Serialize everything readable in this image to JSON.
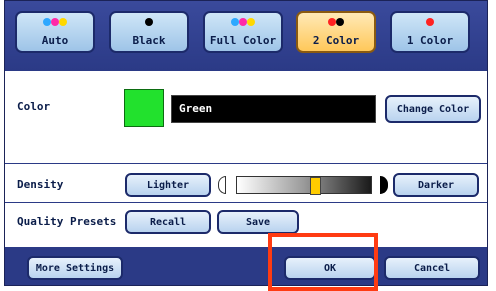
{
  "color_modes": [
    {
      "label": "Auto",
      "dots": [
        "#2ea8ff",
        "#ff2aa8",
        "#ffd800"
      ],
      "selected": false
    },
    {
      "label": "Black",
      "dots": [
        "#000000"
      ],
      "selected": false
    },
    {
      "label": "Full Color",
      "dots": [
        "#2ea8ff",
        "#ff2aa8",
        "#ffd800"
      ],
      "selected": false
    },
    {
      "label": "2 Color",
      "dots": [
        "#ff2222",
        "#000000"
      ],
      "selected": true
    },
    {
      "label": "1 Color",
      "dots": [
        "#ff2222"
      ],
      "selected": false
    }
  ],
  "color_row": {
    "label": "Color",
    "swatch_color": "#22e12d",
    "value": "Green",
    "change_button": "Change Color"
  },
  "density_row": {
    "label": "Density",
    "lighter_button": "Lighter",
    "darker_button": "Darker",
    "level": 0.58
  },
  "quality_row": {
    "label": "Quality Presets",
    "recall_button": "Recall",
    "save_button": "Save"
  },
  "footer": {
    "more_settings": "More Settings",
    "ok": "OK",
    "cancel": "Cancel"
  }
}
